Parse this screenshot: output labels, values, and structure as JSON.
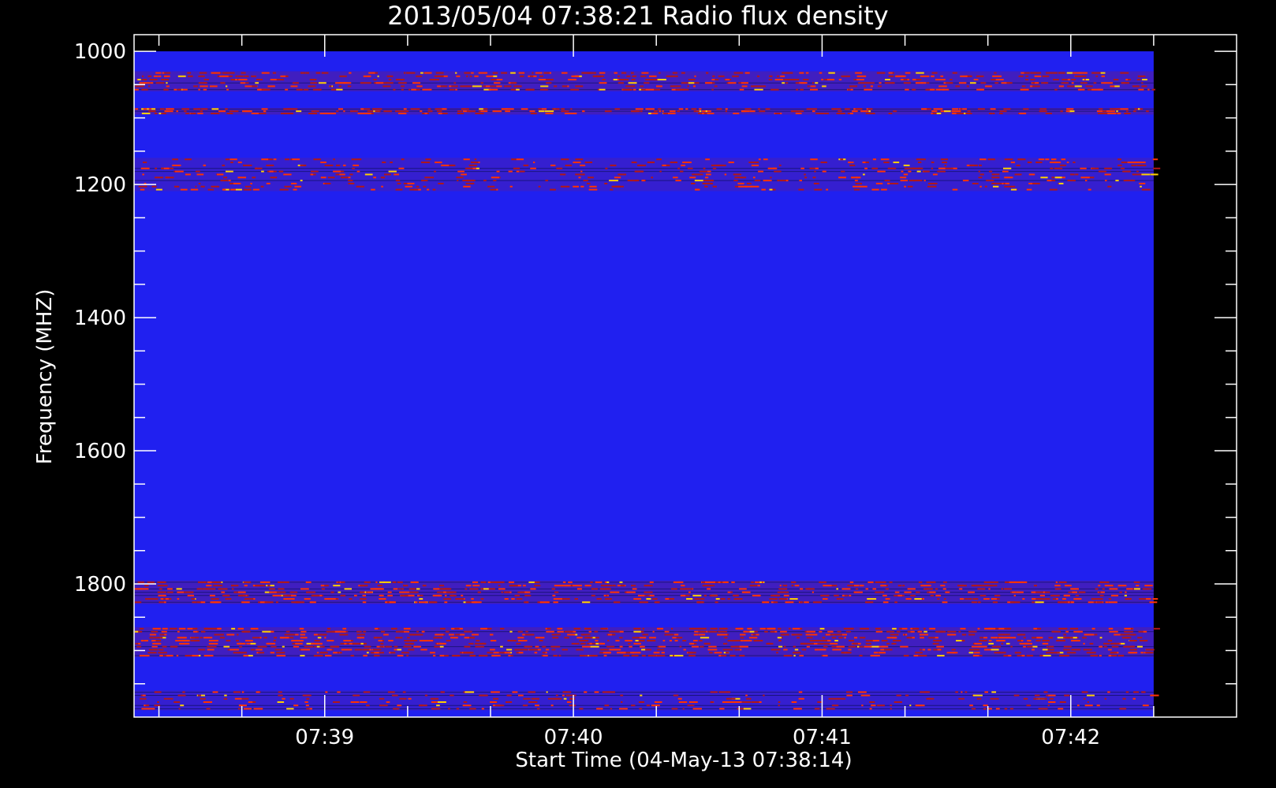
{
  "chart_data": {
    "type": "heatmap",
    "title": "2013/05/04 07:38:21 Radio flux density",
    "xlabel": "Start Time (04-May-13 07:38:14)",
    "ylabel": "Frequency (MHZ)",
    "y_axis_inverted": true,
    "ylim": [
      975,
      2000
    ],
    "y_data_range": [
      1000,
      2000
    ],
    "yticks": [
      1000,
      1200,
      1400,
      1600,
      1800
    ],
    "ytick_labels": [
      "1000",
      "1200",
      "1400",
      "1600",
      "1800"
    ],
    "xlim": [
      "07:38:14",
      "07:42:40"
    ],
    "x_data_range": [
      "07:38:14",
      "07:42:20"
    ],
    "xticks": [
      "07:39",
      "07:40",
      "07:41",
      "07:42"
    ],
    "xtick_labels": [
      "07:39",
      "07:40",
      "07:41",
      "07:42"
    ],
    "background_color": "#2020f0",
    "emission_bands_mhz": [
      {
        "from": 1030,
        "to": 1060,
        "level": "high"
      },
      {
        "from": 1085,
        "to": 1095,
        "level": "high"
      },
      {
        "from": 1160,
        "to": 1210,
        "level": "medium"
      },
      {
        "from": 1795,
        "to": 1830,
        "level": "high"
      },
      {
        "from": 1865,
        "to": 1910,
        "level": "high"
      },
      {
        "from": 1960,
        "to": 1990,
        "level": "medium"
      }
    ],
    "colors": {
      "low": "#2020f0",
      "medium": "#b01818",
      "high": "#ff3300",
      "peak": "#ffd000"
    },
    "grid": false,
    "legend": "none"
  }
}
